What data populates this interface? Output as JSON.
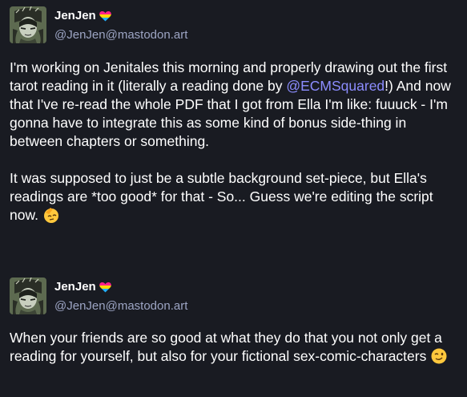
{
  "posts": [
    {
      "display_name": "JenJen",
      "name_emoji_icon": "pansexual-heart-icon",
      "handle": "@JenJen@mastodon.art",
      "paragraph1_part1": "I'm working on Jenitales this morning and properly drawing out the first tarot reading in it (literally a reading done by ",
      "mention": "@ECMSquared",
      "paragraph1_part2": "!) And now that I've re-read the whole PDF that I got from Ella I'm like: fuuuck - I'm gonna have to integrate this as some kind of bonus side-thing in between chapters or something.",
      "paragraph2": "It was supposed to just be a subtle background set-piece, but Ella's readings are *too good* for that - So... Guess we're editing the script now.",
      "trailing_emoji_icon": "saluting-face-icon"
    },
    {
      "display_name": "JenJen",
      "name_emoji_icon": "pansexual-heart-icon",
      "handle": "@JenJen@mastodon.art",
      "paragraph1": "When your friends are so good at what they do that you not only get a reading for yourself, but also for your fictional sex-comic-characters",
      "trailing_emoji_icon": "winking-face-icon"
    }
  ],
  "colors": {
    "background": "#191b22",
    "text": "#ffffff",
    "handle": "#9da5c4",
    "mention": "#8c8dff",
    "heart_top": "#ff218c",
    "heart_mid": "#ffd800",
    "heart_bottom": "#21b1ff"
  }
}
